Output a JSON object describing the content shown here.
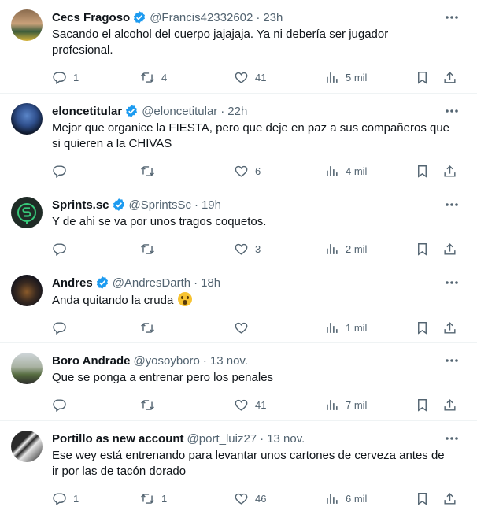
{
  "colors": {
    "verified": "#1d9bf0",
    "text": "#0f1419",
    "muted": "#536471",
    "divider": "#eff3f4"
  },
  "icons": {
    "reply": "speech-bubble-icon",
    "retweet": "retweet-arrows-icon",
    "like": "heart-icon",
    "views": "bar-chart-icon",
    "bookmark": "bookmark-icon",
    "share": "share-upload-icon",
    "more": "ellipsis-icon",
    "verified": "verified-badge-icon"
  },
  "tweets": [
    {
      "name": "Cecs Fragoso",
      "verified": true,
      "handle": "@Francis42332602",
      "separator": "·",
      "time": "23h",
      "text": "Sacando el alcohol del cuerpo jajajaja. Ya ni debería ser jugador\nprofesional.",
      "replies": "1",
      "retweets": "4",
      "likes": "41",
      "views": "5 mil"
    },
    {
      "name": "eloncetitular",
      "verified": true,
      "handle": "@eloncetitular",
      "separator": "·",
      "time": "22h",
      "text": "Mejor que organice la FIESTA, pero que deje en paz a sus compañeros que\nsi quieren a la CHIVAS",
      "replies": "",
      "retweets": "",
      "likes": "6",
      "views": "4 mil"
    },
    {
      "name": "Sprints.sc",
      "verified": true,
      "handle": "@SprintsSc",
      "separator": "·",
      "time": "19h",
      "text": "Y de ahi se va por unos tragos coquetos.",
      "replies": "",
      "retweets": "",
      "likes": "3",
      "views": "2 mil"
    },
    {
      "name": "Andres",
      "verified": true,
      "handle": "@AndresDarth",
      "separator": "·",
      "time": "18h",
      "text": "Anda quitando la cruda",
      "replies": "",
      "retweets": "",
      "likes": "",
      "views": "1 mil"
    },
    {
      "name": "Boro Andrade",
      "verified": false,
      "handle": "@yosoyboro",
      "separator": "·",
      "time": "13 nov.",
      "text": "Que se ponga a entrenar pero los penales",
      "replies": "",
      "retweets": "",
      "likes": "41",
      "views": "7 mil"
    },
    {
      "name": "Portillo as new account",
      "verified": false,
      "handle": "@port_luiz27",
      "separator": "·",
      "time": "13 nov.",
      "text": "Ese wey está entrenando para levantar unos cartones de cerveza antes de\nir por las de tacón dorado",
      "replies": "1",
      "retweets": "1",
      "likes": "46",
      "views": "6 mil"
    }
  ]
}
